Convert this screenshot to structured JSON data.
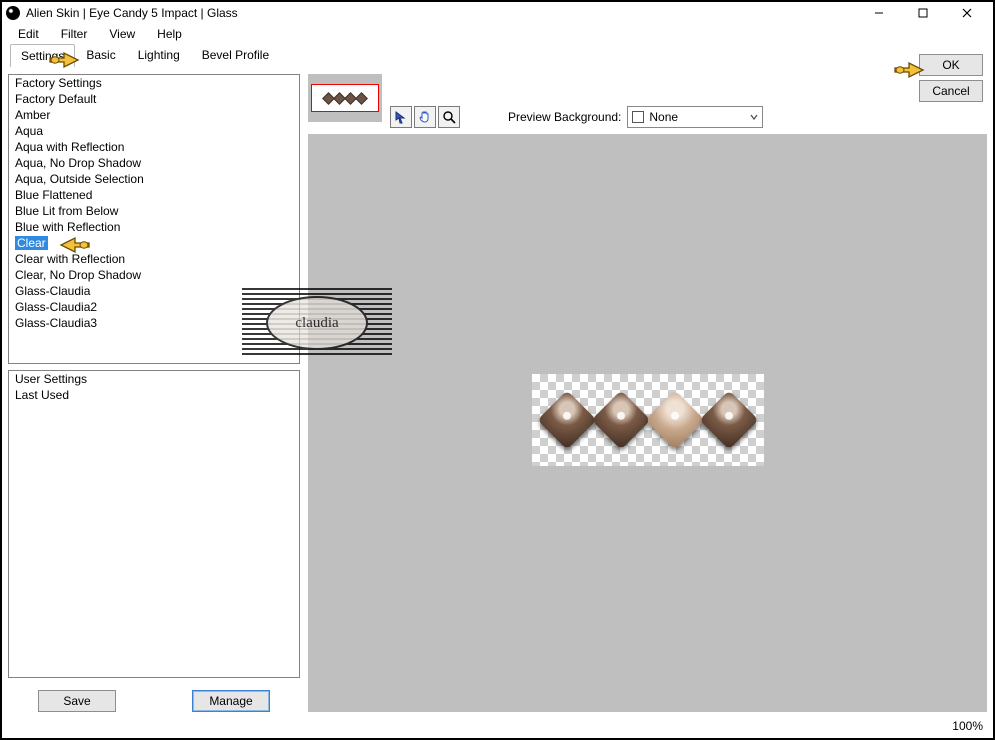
{
  "window": {
    "title": "Alien Skin | Eye Candy 5 Impact | Glass"
  },
  "menu": {
    "items": [
      "Edit",
      "Filter",
      "View",
      "Help"
    ]
  },
  "tabs": {
    "items": [
      "Settings",
      "Basic",
      "Lighting",
      "Bevel Profile"
    ],
    "active": 0
  },
  "factory_list": {
    "header": "Factory Settings",
    "items": [
      "Factory Default",
      "Amber",
      "Aqua",
      "Aqua with Reflection",
      "Aqua, No Drop Shadow",
      "Aqua, Outside Selection",
      "Blue Flattened",
      "Blue Lit from Below",
      "Blue with Reflection",
      "Clear",
      "Clear with Reflection",
      "Clear, No Drop Shadow",
      "Glass-Claudia",
      "Glass-Claudia2",
      "Glass-Claudia3"
    ],
    "selected_index": 9
  },
  "user_list": {
    "items": [
      "User Settings",
      "Last Used"
    ]
  },
  "buttons": {
    "save": "Save",
    "manage": "Manage",
    "ok": "OK",
    "cancel": "Cancel"
  },
  "preview": {
    "label": "Preview Background:",
    "combo_value": "None"
  },
  "status": {
    "zoom": "100%"
  },
  "watermark": {
    "text": "claudia"
  }
}
